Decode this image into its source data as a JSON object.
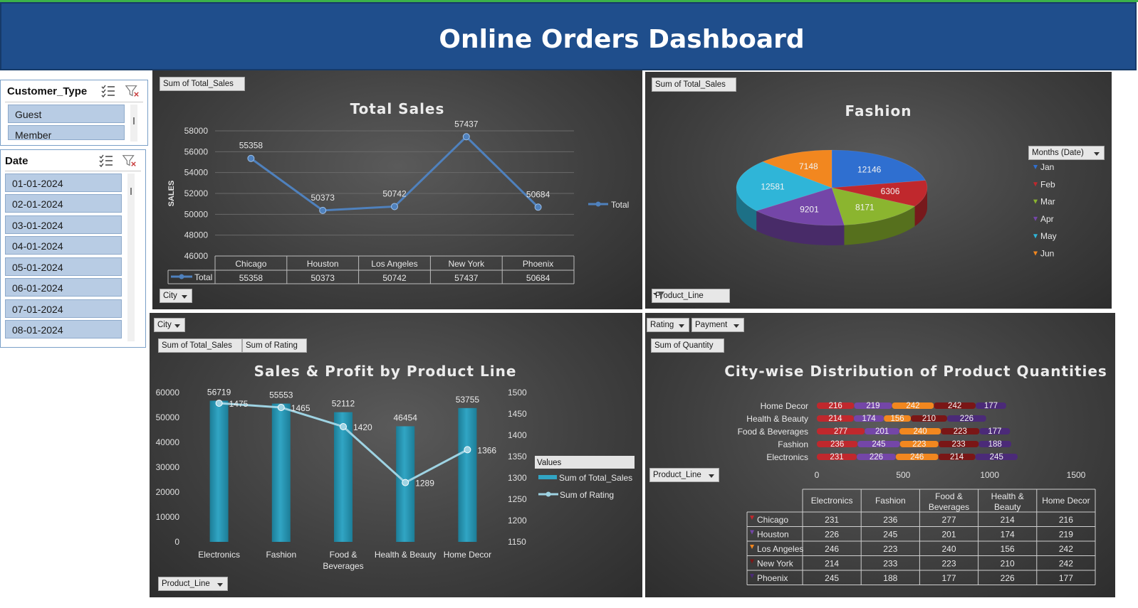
{
  "header": {
    "title": "Online Orders Dashboard"
  },
  "slicers": {
    "customer_type": {
      "title": "Customer_Type",
      "items": [
        "Guest",
        "Member"
      ]
    },
    "date": {
      "title": "Date",
      "items": [
        "01-01-2024",
        "02-01-2024",
        "03-01-2024",
        "04-01-2024",
        "05-01-2024",
        "06-01-2024",
        "07-01-2024",
        "08-01-2024"
      ]
    }
  },
  "total_sales_panel": {
    "value_button": "Sum of Total_Sales",
    "axis_button": "City",
    "table_row_label": "Total",
    "legend_label": "Total"
  },
  "fashion_panel": {
    "value_button": "Sum of Total_Sales",
    "filter_button": "Product_Line",
    "legend_button": "Months (Date)"
  },
  "product_line_panel": {
    "filter_button": "City",
    "value_buttons": [
      "Sum of Total_Sales",
      "Sum of Rating"
    ],
    "axis_button": "Product_Line",
    "legend_title": "Values"
  },
  "city_panel": {
    "filter_buttons": [
      "Rating",
      "Payment"
    ],
    "value_button": "Sum of Quantity",
    "axis_button": "Product_Line"
  },
  "colors": {
    "banner": "#1f4e8c",
    "slicer_item": "#b8cce4",
    "line": "#4f81bd",
    "bar": "#31a5c4",
    "rating_line": "#9ed3e3",
    "jan": "#2f6fd0",
    "feb": "#c0282d",
    "mar": "#8bb52f",
    "apr": "#7446a8",
    "may": "#2fb5d8",
    "jun": "#f2871f"
  },
  "chart_data": [
    {
      "type": "line",
      "title": "Total Sales",
      "ylabel": "SALES",
      "categories": [
        "Chicago",
        "Houston",
        "Los Angeles",
        "New York",
        "Phoenix"
      ],
      "series": [
        {
          "name": "Total",
          "values": [
            55358,
            50373,
            50742,
            57437,
            50684
          ]
        }
      ],
      "ylim": [
        46000,
        58000
      ],
      "yticks": [
        58000,
        56000,
        54000,
        52000,
        50000,
        48000,
        46000
      ],
      "grid": true,
      "legend": "right",
      "data_table": true
    },
    {
      "type": "pie",
      "title": "Fashion",
      "categories": [
        "Jan",
        "Feb",
        "Mar",
        "Apr",
        "May",
        "Jun"
      ],
      "values": [
        12146,
        6306,
        8171,
        9201,
        12581,
        7148
      ],
      "legend": "right"
    },
    {
      "type": "bar",
      "title": "Sales & Profit by Product Line",
      "categories": [
        "Electronics",
        "Fashion",
        "Food & Beverages",
        "Health & Beauty",
        "Home Decor"
      ],
      "series": [
        {
          "name": "Sum of Total_Sales",
          "values": [
            56719,
            55553,
            52112,
            46454,
            53755
          ],
          "axis": "left",
          "kind": "bar"
        },
        {
          "name": "Sum of Rating",
          "values": [
            1475,
            1465,
            1420,
            1289,
            1366
          ],
          "axis": "right",
          "kind": "line"
        }
      ],
      "ylim": [
        0,
        60000
      ],
      "yticks": [
        60000,
        50000,
        40000,
        30000,
        20000,
        10000,
        0
      ],
      "y2lim": [
        1150,
        1500
      ],
      "y2ticks": [
        1500,
        1450,
        1400,
        1350,
        1300,
        1250,
        1200,
        1150
      ],
      "legend": "right"
    },
    {
      "type": "bar",
      "orientation": "horizontal",
      "stacked": true,
      "title": "City-wise Distribution of Product Quantities",
      "categories": [
        "Electronics",
        "Fashion",
        "Food & Beverages",
        "Health & Beauty",
        "Home Decor"
      ],
      "table_headers": [
        "Electronics",
        "Fashion",
        "Food & Beverages",
        "Health & Beauty",
        "Home Decor"
      ],
      "series": [
        {
          "name": "Chicago",
          "values": [
            231,
            236,
            277,
            214,
            216
          ]
        },
        {
          "name": "Houston",
          "values": [
            226,
            245,
            201,
            174,
            219
          ]
        },
        {
          "name": "Los Angeles",
          "values": [
            246,
            223,
            240,
            156,
            242
          ]
        },
        {
          "name": "New York",
          "values": [
            214,
            233,
            223,
            210,
            242
          ]
        },
        {
          "name": "Phoenix",
          "values": [
            245,
            188,
            177,
            226,
            177
          ]
        }
      ],
      "xlim": [
        0,
        1500
      ],
      "xticks": [
        0,
        500,
        1000,
        1500
      ],
      "data_table": true
    }
  ]
}
